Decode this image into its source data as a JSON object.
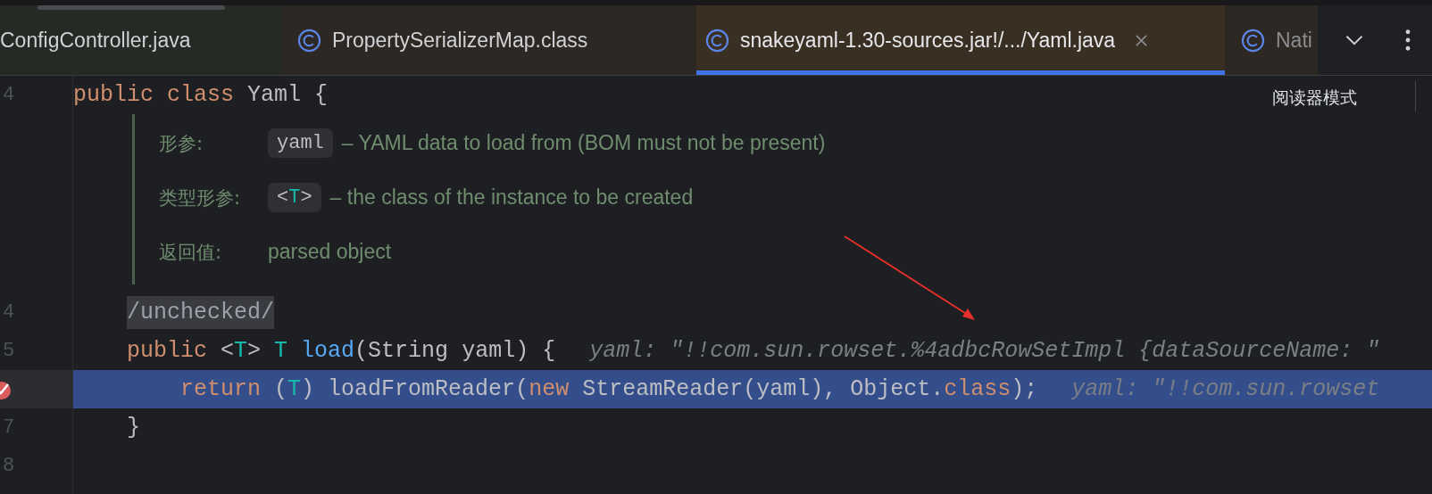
{
  "tabs": [
    {
      "label": "ConfigController.java",
      "icon": false,
      "selected": false,
      "color": "#252a25"
    },
    {
      "label": "PropertySerializerMap.class",
      "icon": true,
      "selected": false,
      "color": "#2d2823"
    },
    {
      "label": "snakeyaml-1.30-sources.jar!/.../Yaml.java",
      "icon": true,
      "selected": true,
      "color": "#3a2f23"
    },
    {
      "label": "Nati",
      "icon": true,
      "selected": false,
      "color": "#2d2823"
    }
  ],
  "reader_mode": "阅读器模式",
  "editor": {
    "rows": [
      {
        "kind": "code",
        "number": "4",
        "selected": false,
        "breakpoint": false,
        "tokens": [
          {
            "kind": "keyword",
            "text": "public "
          },
          {
            "kind": "keyword",
            "text": "class "
          },
          {
            "kind": "plain",
            "text": "Yaml {"
          }
        ]
      },
      {
        "kind": "doc",
        "entries": [
          {
            "label": "形参:",
            "chip": [
              {
                "kind": "plain",
                "text": "yaml"
              }
            ],
            "text": "– YAML data to load from (BOM must not be present)"
          },
          {
            "label": "类型形参:",
            "chip": [
              {
                "kind": "plain",
                "text": "<"
              },
              {
                "kind": "type",
                "text": "T"
              },
              {
                "kind": "plain",
                "text": ">"
              }
            ],
            "text": "– the class of the instance to be created"
          },
          {
            "label": "返回值:",
            "text": "parsed object"
          }
        ]
      },
      {
        "kind": "code",
        "number": "4",
        "selected": false,
        "breakpoint": false,
        "tokens": [
          {
            "kind": "folded",
            "text": "/unchecked/"
          }
        ]
      },
      {
        "kind": "code",
        "number": "5",
        "selected": false,
        "breakpoint": false,
        "tokens": [
          {
            "kind": "keyword",
            "text": "public "
          },
          {
            "kind": "plain",
            "text": "<"
          },
          {
            "kind": "type",
            "text": "T"
          },
          {
            "kind": "plain",
            "text": "> "
          },
          {
            "kind": "type",
            "text": "T "
          },
          {
            "kind": "method",
            "text": "load"
          },
          {
            "kind": "plain",
            "text": "(String yaml) {"
          }
        ],
        "hint": "yaml: \"!!com.sun.rowset.%4adbcRowSetImpl {dataSourceName: \""
      },
      {
        "kind": "code",
        "selected": true,
        "breakpoint": true,
        "tokens": [
          {
            "kind": "keyword",
            "text": "return "
          },
          {
            "kind": "plain",
            "text": "("
          },
          {
            "kind": "type",
            "text": "T"
          },
          {
            "kind": "plain",
            "text": ") loadFromReader("
          },
          {
            "kind": "keyword",
            "text": "new "
          },
          {
            "kind": "plain",
            "text": "StreamReader(yaml), Object."
          },
          {
            "kind": "keyword",
            "text": "class"
          },
          {
            "kind": "plain",
            "text": ");"
          }
        ],
        "hint": "yaml: \"!!com.sun.rowset"
      },
      {
        "kind": "code",
        "number": "7",
        "selected": false,
        "breakpoint": false,
        "tokens": [
          {
            "kind": "plain",
            "text": "}"
          }
        ]
      },
      {
        "kind": "code",
        "number": "8",
        "selected": false,
        "breakpoint": false,
        "tokens": []
      }
    ]
  }
}
